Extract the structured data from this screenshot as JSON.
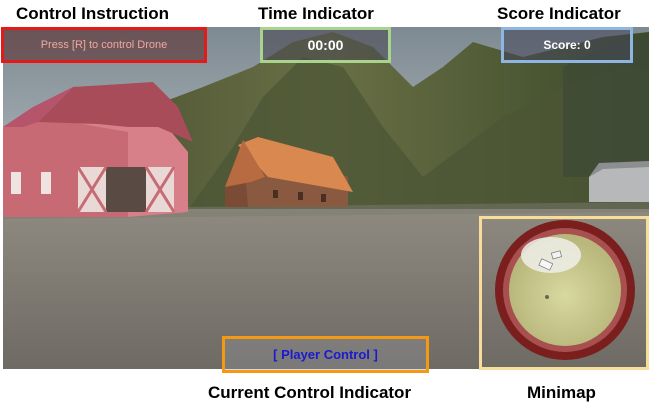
{
  "annotations": {
    "control_instruction": "Control Instruction",
    "time_indicator": "Time Indicator",
    "score_indicator": "Score Indicator",
    "current_control_indicator": "Current Control Indicator",
    "minimap": "Minimap"
  },
  "hud": {
    "control_instruction_text": "Press [R] to control Drone",
    "time_text": "00:00",
    "score_text": "Score: 0",
    "current_control_text": "[ Player Control ]"
  },
  "colors": {
    "control_instruction_border": "#e21a1a",
    "time_border": "#a9d48d",
    "score_border": "#8fb5e3",
    "current_control_border": "#f49a12",
    "minimap_border": "#f7dc9a",
    "current_control_text": "#1a1ad0"
  },
  "scene": {
    "objects": [
      "red-barn",
      "orange-roof-house",
      "grey-house",
      "green-hills",
      "forest",
      "gravel-ground"
    ]
  }
}
